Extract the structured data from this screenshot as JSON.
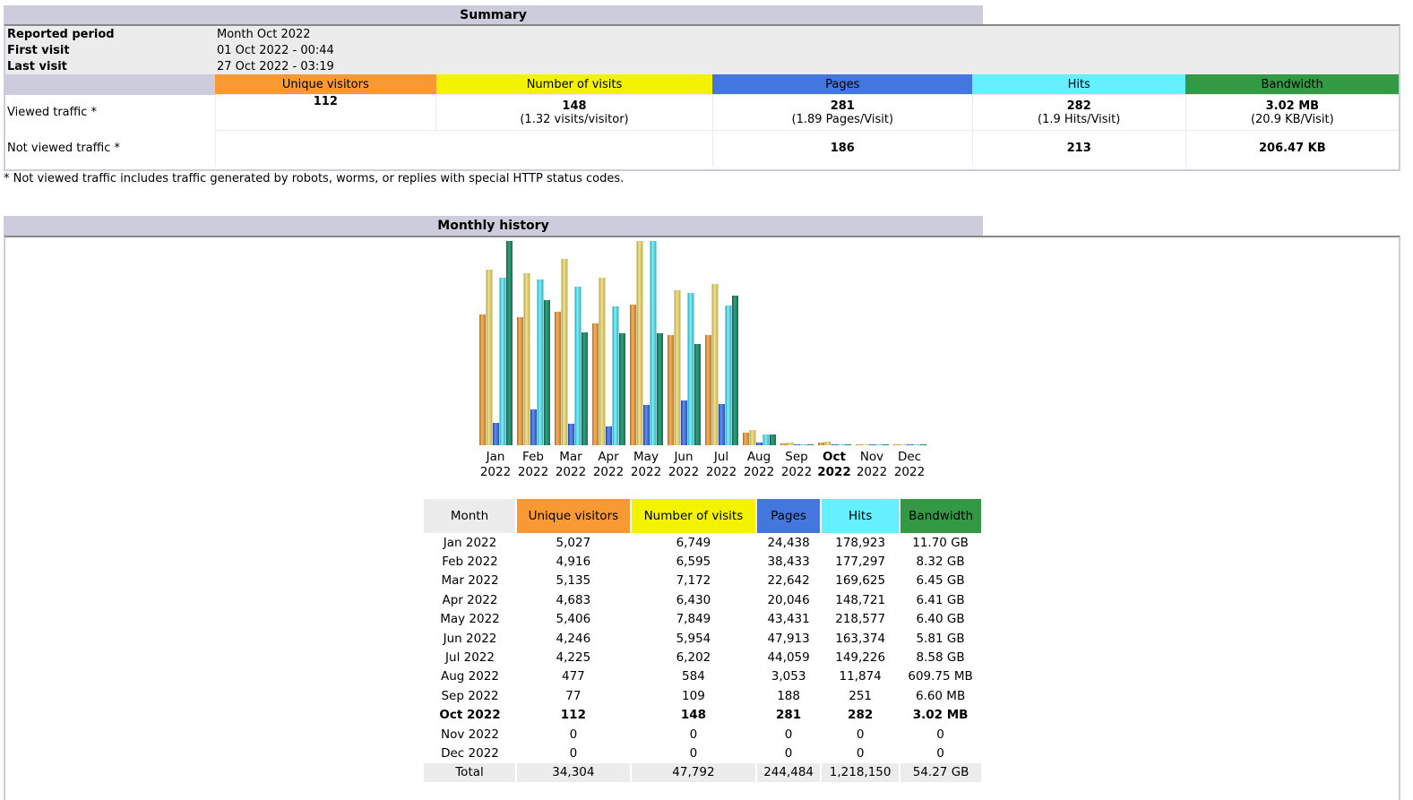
{
  "colors": {
    "visitors": "#f89933",
    "visits": "#f3f300",
    "pages": "#4477dd",
    "hits": "#66f0ff",
    "bandwidth": "#339944",
    "header": "#ccccdd",
    "light": "#ececec"
  },
  "summary": {
    "title": "Summary",
    "reported_period_label": "Reported period",
    "reported_period_value": "Month Oct 2022",
    "first_visit_label": "First visit",
    "first_visit_value": "01 Oct 2022 - 00:44",
    "last_visit_label": "Last visit",
    "last_visit_value": "27 Oct 2022 - 03:19",
    "columns": [
      "Unique visitors",
      "Number of visits",
      "Pages",
      "Hits",
      "Bandwidth"
    ],
    "viewed_label": "Viewed traffic *",
    "viewed": [
      {
        "value": "112",
        "sub": ""
      },
      {
        "value": "148",
        "sub": "(1.32 visits/visitor)"
      },
      {
        "value": "281",
        "sub": "(1.89 Pages/Visit)"
      },
      {
        "value": "282",
        "sub": "(1.9 Hits/Visit)"
      },
      {
        "value": "3.02 MB",
        "sub": "(20.9 KB/Visit)"
      }
    ],
    "not_viewed_label": "Not viewed traffic *",
    "not_viewed": [
      "",
      "186",
      "213",
      "206.47 KB"
    ],
    "footnote": "* Not viewed traffic includes traffic generated by robots, worms, or replies with special HTTP status codes."
  },
  "history": {
    "title": "Monthly history",
    "columns": [
      "Month",
      "Unique visitors",
      "Number of visits",
      "Pages",
      "Hits",
      "Bandwidth"
    ],
    "rows": [
      [
        "Jan 2022",
        "5,027",
        "6,749",
        "24,438",
        "178,923",
        "11.70 GB"
      ],
      [
        "Feb 2022",
        "4,916",
        "6,595",
        "38,433",
        "177,297",
        "8.32 GB"
      ],
      [
        "Mar 2022",
        "5,135",
        "7,172",
        "22,642",
        "169,625",
        "6.45 GB"
      ],
      [
        "Apr 2022",
        "4,683",
        "6,430",
        "20,046",
        "148,721",
        "6.41 GB"
      ],
      [
        "May 2022",
        "5,406",
        "7,849",
        "43,431",
        "218,577",
        "6.40 GB"
      ],
      [
        "Jun 2022",
        "4,246",
        "5,954",
        "47,913",
        "163,374",
        "5.81 GB"
      ],
      [
        "Jul 2022",
        "4,225",
        "6,202",
        "44,059",
        "149,226",
        "8.58 GB"
      ],
      [
        "Aug 2022",
        "477",
        "584",
        "3,053",
        "11,874",
        "609.75 MB"
      ],
      [
        "Sep 2022",
        "77",
        "109",
        "188",
        "251",
        "6.60 MB"
      ],
      [
        "Oct 2022",
        "112",
        "148",
        "281",
        "282",
        "3.02 MB"
      ],
      [
        "Nov 2022",
        "0",
        "0",
        "0",
        "0",
        "0"
      ],
      [
        "Dec 2022",
        "0",
        "0",
        "0",
        "0",
        "0"
      ]
    ],
    "current_month": "Oct 2022",
    "total": [
      "Total",
      "34,304",
      "47,792",
      "244,484",
      "1,218,150",
      "54.27 GB"
    ]
  },
  "chart_data": {
    "type": "bar",
    "title": "Monthly history",
    "categories": [
      "Jan 2022",
      "Feb 2022",
      "Mar 2022",
      "Apr 2022",
      "May 2022",
      "Jun 2022",
      "Jul 2022",
      "Aug 2022",
      "Sep 2022",
      "Oct 2022",
      "Nov 2022",
      "Dec 2022"
    ],
    "x_month": [
      "Jan",
      "Feb",
      "Mar",
      "Apr",
      "May",
      "Jun",
      "Jul",
      "Aug",
      "Sep",
      "Oct",
      "Nov",
      "Dec"
    ],
    "x_year": "2022",
    "highlight": "Oct",
    "series": [
      {
        "name": "Unique visitors",
        "values": [
          5027,
          4916,
          5135,
          4683,
          5406,
          4246,
          4225,
          477,
          77,
          112,
          0,
          0
        ]
      },
      {
        "name": "Number of visits",
        "values": [
          6749,
          6595,
          7172,
          6430,
          7849,
          5954,
          6202,
          584,
          109,
          148,
          0,
          0
        ]
      },
      {
        "name": "Pages",
        "values": [
          24438,
          38433,
          22642,
          20046,
          43431,
          47913,
          44059,
          3053,
          188,
          281,
          0,
          0
        ]
      },
      {
        "name": "Hits",
        "values": [
          178923,
          177297,
          169625,
          148721,
          218577,
          163374,
          149226,
          11874,
          251,
          282,
          0,
          0
        ]
      },
      {
        "name": "Bandwidth (GB)",
        "values": [
          11.7,
          8.32,
          6.45,
          6.41,
          6.4,
          5.81,
          8.58,
          0.60975,
          0.0066,
          0.00302,
          0,
          0
        ]
      }
    ],
    "legend": "none",
    "grid": false
  }
}
